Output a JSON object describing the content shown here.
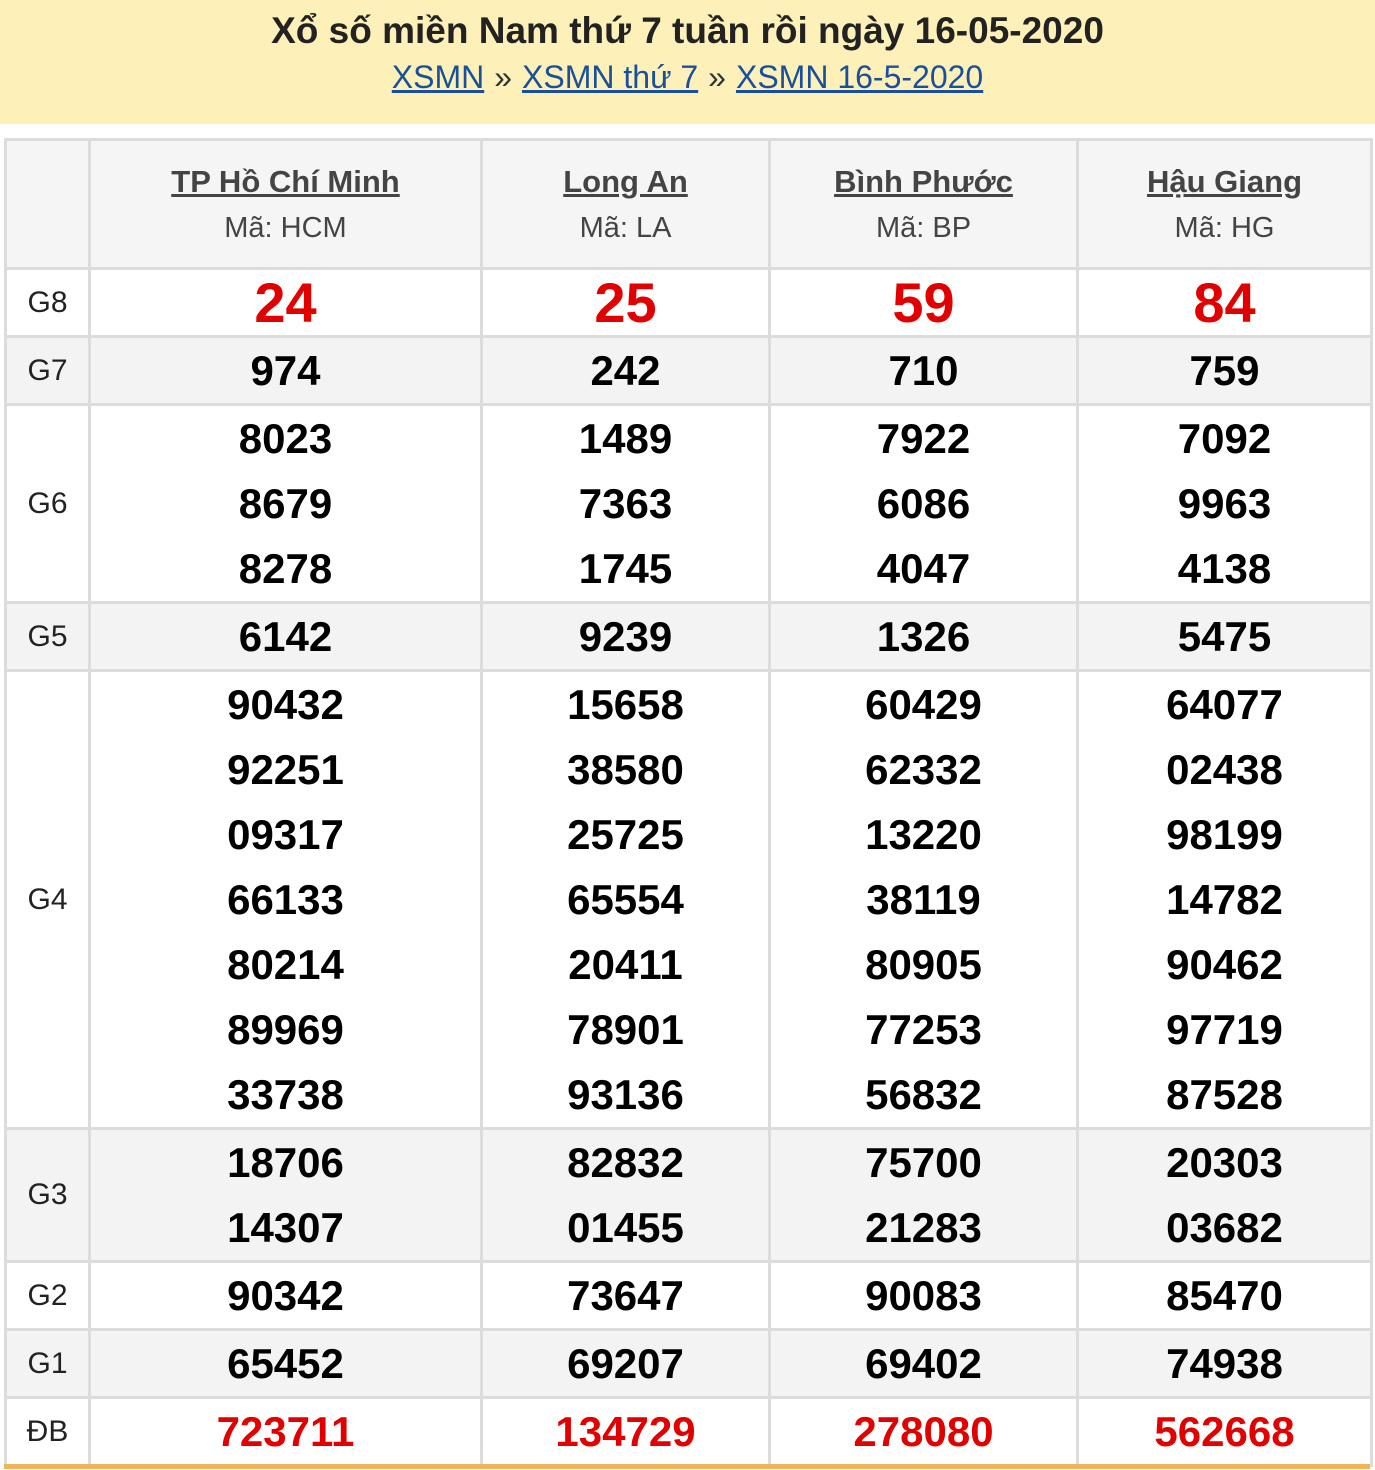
{
  "header": {
    "title": "Xổ số miền Nam thứ 7 tuần rồi ngày 16-05-2020",
    "breadcrumb": [
      "XSMN",
      "XSMN thứ 7",
      "XSMN 16-5-2020"
    ],
    "separator": "»"
  },
  "provinces": [
    {
      "name": "TP Hồ Chí Minh",
      "code": "Mã: HCM"
    },
    {
      "name": "Long An",
      "code": "Mã: LA"
    },
    {
      "name": "Bình Phước",
      "code": "Mã: BP"
    },
    {
      "name": "Hậu Giang",
      "code": "Mã: HG"
    }
  ],
  "prizes": [
    {
      "id": "g8",
      "label": "G8",
      "style": "red-big",
      "values": [
        [
          "24"
        ],
        [
          "25"
        ],
        [
          "59"
        ],
        [
          "84"
        ]
      ]
    },
    {
      "id": "g7",
      "label": "G7",
      "style": "normal",
      "values": [
        [
          "974"
        ],
        [
          "242"
        ],
        [
          "710"
        ],
        [
          "759"
        ]
      ]
    },
    {
      "id": "g6",
      "label": "G6",
      "style": "normal",
      "values": [
        [
          "8023",
          "8679",
          "8278"
        ],
        [
          "1489",
          "7363",
          "1745"
        ],
        [
          "7922",
          "6086",
          "4047"
        ],
        [
          "7092",
          "9963",
          "4138"
        ]
      ]
    },
    {
      "id": "g5",
      "label": "G5",
      "style": "normal",
      "values": [
        [
          "6142"
        ],
        [
          "9239"
        ],
        [
          "1326"
        ],
        [
          "5475"
        ]
      ]
    },
    {
      "id": "g4",
      "label": "G4",
      "style": "normal",
      "values": [
        [
          "90432",
          "92251",
          "09317",
          "66133",
          "80214",
          "89969",
          "33738"
        ],
        [
          "15658",
          "38580",
          "25725",
          "65554",
          "20411",
          "78901",
          "93136"
        ],
        [
          "60429",
          "62332",
          "13220",
          "38119",
          "80905",
          "77253",
          "56832"
        ],
        [
          "64077",
          "02438",
          "98199",
          "14782",
          "90462",
          "97719",
          "87528"
        ]
      ]
    },
    {
      "id": "g3",
      "label": "G3",
      "style": "normal",
      "values": [
        [
          "18706",
          "14307"
        ],
        [
          "82832",
          "01455"
        ],
        [
          "75700",
          "21283"
        ],
        [
          "20303",
          "03682"
        ]
      ]
    },
    {
      "id": "g2",
      "label": "G2",
      "style": "normal",
      "values": [
        [
          "90342"
        ],
        [
          "73647"
        ],
        [
          "90083"
        ],
        [
          "85470"
        ]
      ]
    },
    {
      "id": "g1",
      "label": "G1",
      "style": "normal",
      "values": [
        [
          "65452"
        ],
        [
          "69207"
        ],
        [
          "69402"
        ],
        [
          "74938"
        ]
      ]
    },
    {
      "id": "db",
      "label": "ĐB",
      "style": "red",
      "values": [
        [
          "723711"
        ],
        [
          "134729"
        ],
        [
          "278080"
        ],
        [
          "562668"
        ]
      ]
    }
  ],
  "colors": {
    "banner_bg": "#fdf0b8",
    "link": "#1a4f9c",
    "special_red": "#e00000",
    "alt_row_bg": "#f3f3f3",
    "bottom_bar": "#f1b25c"
  }
}
